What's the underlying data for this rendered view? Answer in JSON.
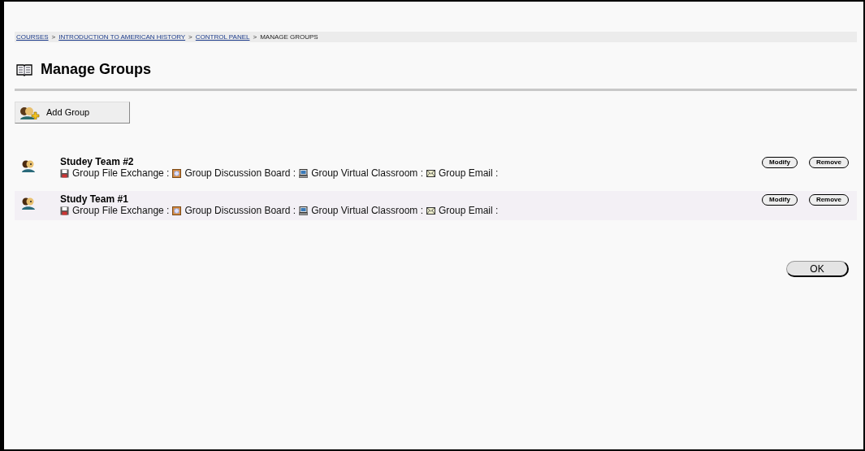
{
  "breadcrumb": [
    {
      "label": "COURSES",
      "link": true
    },
    {
      "label": "INTRODUCTION TO AMERICAN HISTORY",
      "link": true
    },
    {
      "label": "CONTROL PANEL",
      "link": true
    },
    {
      "label": "MANAGE GROUPS",
      "link": false
    }
  ],
  "separator": ">",
  "title": "Manage Groups",
  "add_button": "Add Group",
  "groups": [
    {
      "name": "Studey Team #2",
      "tools": [
        {
          "kind": "file",
          "label": "Group File Exchange :"
        },
        {
          "kind": "board",
          "label": "Group Discussion Board :"
        },
        {
          "kind": "classroom",
          "label": "Group Virtual Classroom :"
        },
        {
          "kind": "email",
          "label": "Group Email :"
        }
      ],
      "actions": [
        "Modify",
        "Remove"
      ]
    },
    {
      "name": "Study Team #1",
      "tools": [
        {
          "kind": "file",
          "label": "Group File Exchange :"
        },
        {
          "kind": "board",
          "label": "Group Discussion Board :"
        },
        {
          "kind": "classroom",
          "label": "Group Virtual Classroom :"
        },
        {
          "kind": "email",
          "label": "Group Email :"
        }
      ],
      "actions": [
        "Modify",
        "Remove"
      ]
    }
  ],
  "ok_button": "OK"
}
